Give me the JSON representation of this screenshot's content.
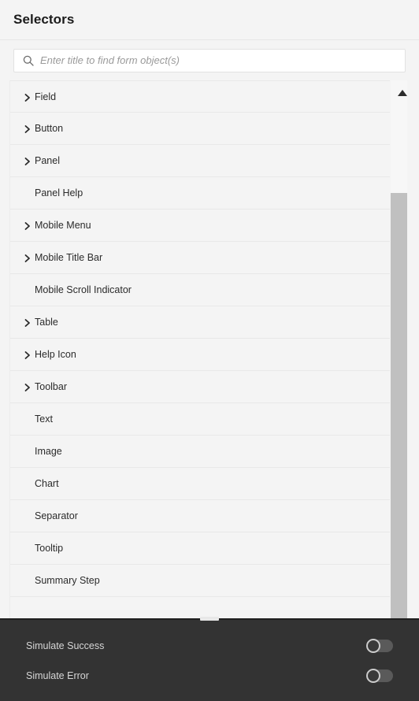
{
  "header": {
    "title": "Selectors"
  },
  "search": {
    "placeholder": "Enter title to find form object(s)",
    "value": "",
    "icon": "search-icon"
  },
  "list": {
    "items": [
      {
        "label": "Field",
        "expandable": true
      },
      {
        "label": "Button",
        "expandable": true
      },
      {
        "label": "Panel",
        "expandable": true
      },
      {
        "label": "Panel Help",
        "expandable": false
      },
      {
        "label": "Mobile Menu",
        "expandable": true
      },
      {
        "label": "Mobile Title Bar",
        "expandable": true
      },
      {
        "label": "Mobile Scroll Indicator",
        "expandable": false
      },
      {
        "label": "Table",
        "expandable": true
      },
      {
        "label": "Help Icon",
        "expandable": true
      },
      {
        "label": "Toolbar",
        "expandable": true
      },
      {
        "label": "Text",
        "expandable": false
      },
      {
        "label": "Image",
        "expandable": false
      },
      {
        "label": "Chart",
        "expandable": false
      },
      {
        "label": "Separator",
        "expandable": false
      },
      {
        "label": "Tooltip",
        "expandable": false
      },
      {
        "label": "Summary Step",
        "expandable": false
      }
    ],
    "chevron_icon": "chevron-right-icon"
  },
  "scrollbar": {
    "up_arrow_icon": "triangle-up-icon",
    "thumb_top_pct": 21,
    "thumb_height_pct": 79
  },
  "bottom_panel": {
    "toggles": [
      {
        "label": "Simulate Success",
        "on": false
      },
      {
        "label": "Simulate Error",
        "on": false
      }
    ]
  },
  "colors": {
    "page_background": "#f4f4f4",
    "row_divider": "#e8e8e8",
    "text_primary": "#2b2b2b",
    "placeholder": "#9a9a9a",
    "dark_panel": "#333333",
    "dark_panel_text": "#d6d6d6",
    "scroll_thumb": "#c0c0c0"
  }
}
